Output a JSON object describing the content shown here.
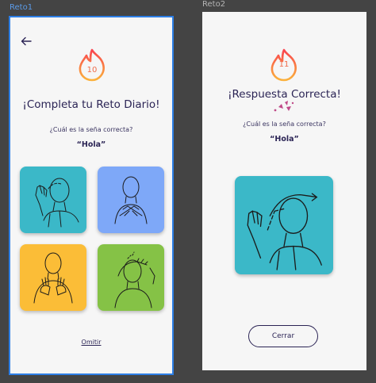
{
  "frames": {
    "reto1": {
      "label": "Reto1",
      "streak": "10",
      "title": "¡Completa tu Reto Diario!",
      "question": "¿Cuál es la seña correcta?",
      "word": "“Hola”",
      "skip_label": "Omitir",
      "options": [
        {
          "icon": "sign-wave-hola",
          "color": "#3bb8c8"
        },
        {
          "icon": "sign-crossed-hands",
          "color": "#7ea8f8"
        },
        {
          "icon": "sign-hands-chest",
          "color": "#fbbd37"
        },
        {
          "icon": "sign-hand-forehead",
          "color": "#85c246"
        }
      ]
    },
    "reto2": {
      "label": "Reto2",
      "streak": "11",
      "title": "¡Respuesta Correcta!",
      "question": "¿Cuál es la seña correcta?",
      "word": "“Hola”",
      "close_label": "Cerrar",
      "answer": {
        "icon": "sign-wave-hola",
        "color": "#3bb8c8"
      }
    }
  },
  "colors": {
    "canvas": "#444444",
    "frame_bg": "#f6f6f6",
    "selected_border": "#2d7fe6",
    "text_dark": "#2b2455",
    "flame": "#ef6c4b"
  }
}
